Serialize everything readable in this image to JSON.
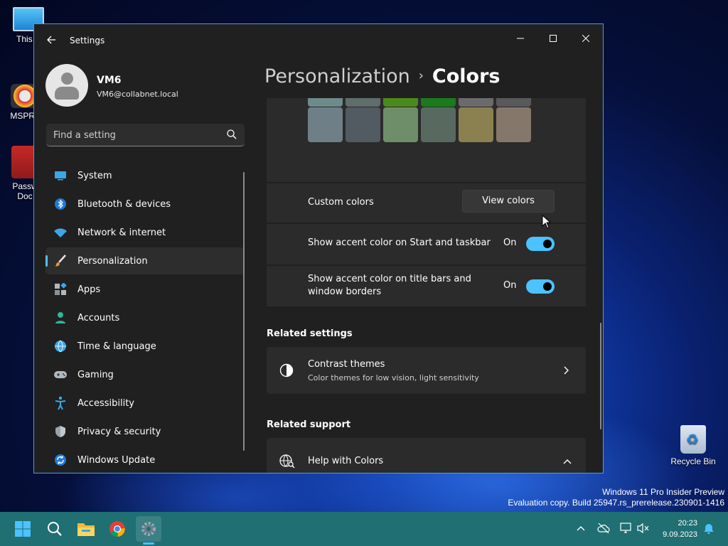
{
  "desktop": {
    "icons": {
      "this_pc": "This P",
      "mspr": "MSPRe",
      "passw": "Passw\nDoc",
      "recycle_bin": "Recycle Bin"
    },
    "watermark": {
      "line1": "Windows 11 Pro Insider Preview",
      "line2": "Evaluation copy. Build 25947.rs_prerelease.230901-1416"
    }
  },
  "window": {
    "title": "Settings",
    "controls": {
      "minimize": "—",
      "maximize": "☐",
      "close": "✕"
    }
  },
  "profile": {
    "name": "VM6",
    "email": "VM6@collabnet.local"
  },
  "search": {
    "placeholder": "Find a setting"
  },
  "nav": {
    "items": [
      {
        "label": "System",
        "icon": "system-icon"
      },
      {
        "label": "Bluetooth & devices",
        "icon": "bluetooth-icon"
      },
      {
        "label": "Network & internet",
        "icon": "network-icon"
      },
      {
        "label": "Personalization",
        "icon": "brush-icon",
        "active": true
      },
      {
        "label": "Apps",
        "icon": "apps-icon"
      },
      {
        "label": "Accounts",
        "icon": "accounts-icon"
      },
      {
        "label": "Time & language",
        "icon": "globe-icon"
      },
      {
        "label": "Gaming",
        "icon": "gamepad-icon"
      },
      {
        "label": "Accessibility",
        "icon": "accessibility-icon"
      },
      {
        "label": "Privacy & security",
        "icon": "shield-icon"
      },
      {
        "label": "Windows Update",
        "icon": "update-icon"
      }
    ]
  },
  "breadcrumb": {
    "parent": "Personalization",
    "separator": "›",
    "current": "Colors"
  },
  "colors": {
    "swatch_colors_row1": [
      "#6e8a8a",
      "#5f6e6a",
      "#4a8a1a",
      "#1b7a1b",
      "#6b6b6b",
      "#595959"
    ],
    "swatch_colors_row2": [
      "#6f7f88",
      "#525a62",
      "#6e8e6a",
      "#586a5f",
      "#8a8050",
      "#85786a"
    ],
    "custom_colors_label": "Custom colors",
    "view_colors_button": "View colors",
    "accent_start_label": "Show accent color on Start and taskbar",
    "accent_start_state": "On",
    "accent_title_label_line1": "Show accent color on title bars and",
    "accent_title_label_line2": "window borders",
    "accent_title_state": "On",
    "accent_color": "#4cc2ff"
  },
  "related_settings": {
    "heading": "Related settings",
    "contrast_title": "Contrast themes",
    "contrast_sub": "Color themes for low vision, light sensitivity"
  },
  "related_support": {
    "heading": "Related support",
    "help_title": "Help with Colors"
  },
  "taskbar": {
    "clock_time": "20:23",
    "clock_date": "9.09.2023"
  }
}
